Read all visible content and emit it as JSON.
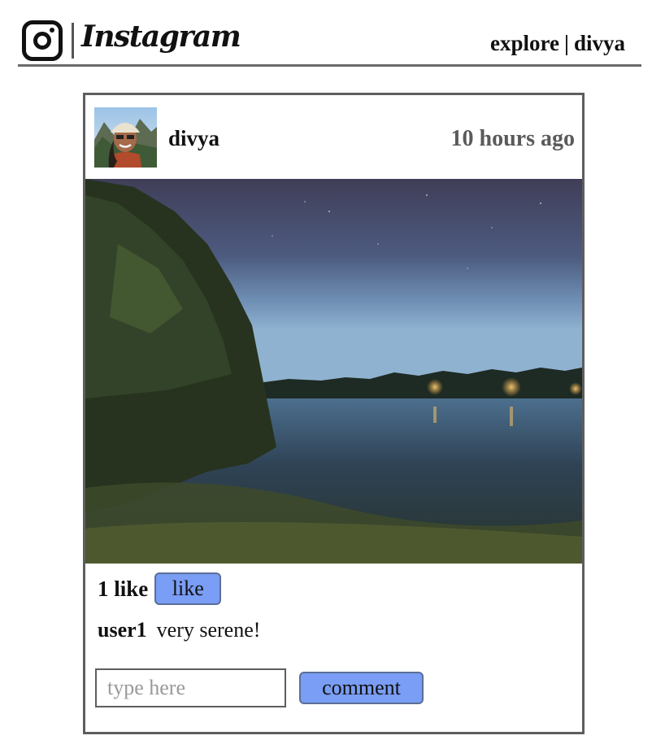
{
  "app": {
    "logo_text": "Instagram",
    "nav": {
      "explore": "explore",
      "separator": "|",
      "user": "divya"
    }
  },
  "post": {
    "author": "divya",
    "timestamp": "10 hours ago",
    "likes_text": "1 like",
    "like_button": "like",
    "comments": [
      {
        "user": "user1",
        "text": "very serene!"
      }
    ],
    "comment_input_placeholder": "type here",
    "comment_button": "comment"
  },
  "colors": {
    "button_bg": "#7a9df5",
    "border": "#5e5e5e",
    "timestamp": "#5a5a5a"
  },
  "icons": [
    "instagram-logo-icon"
  ]
}
